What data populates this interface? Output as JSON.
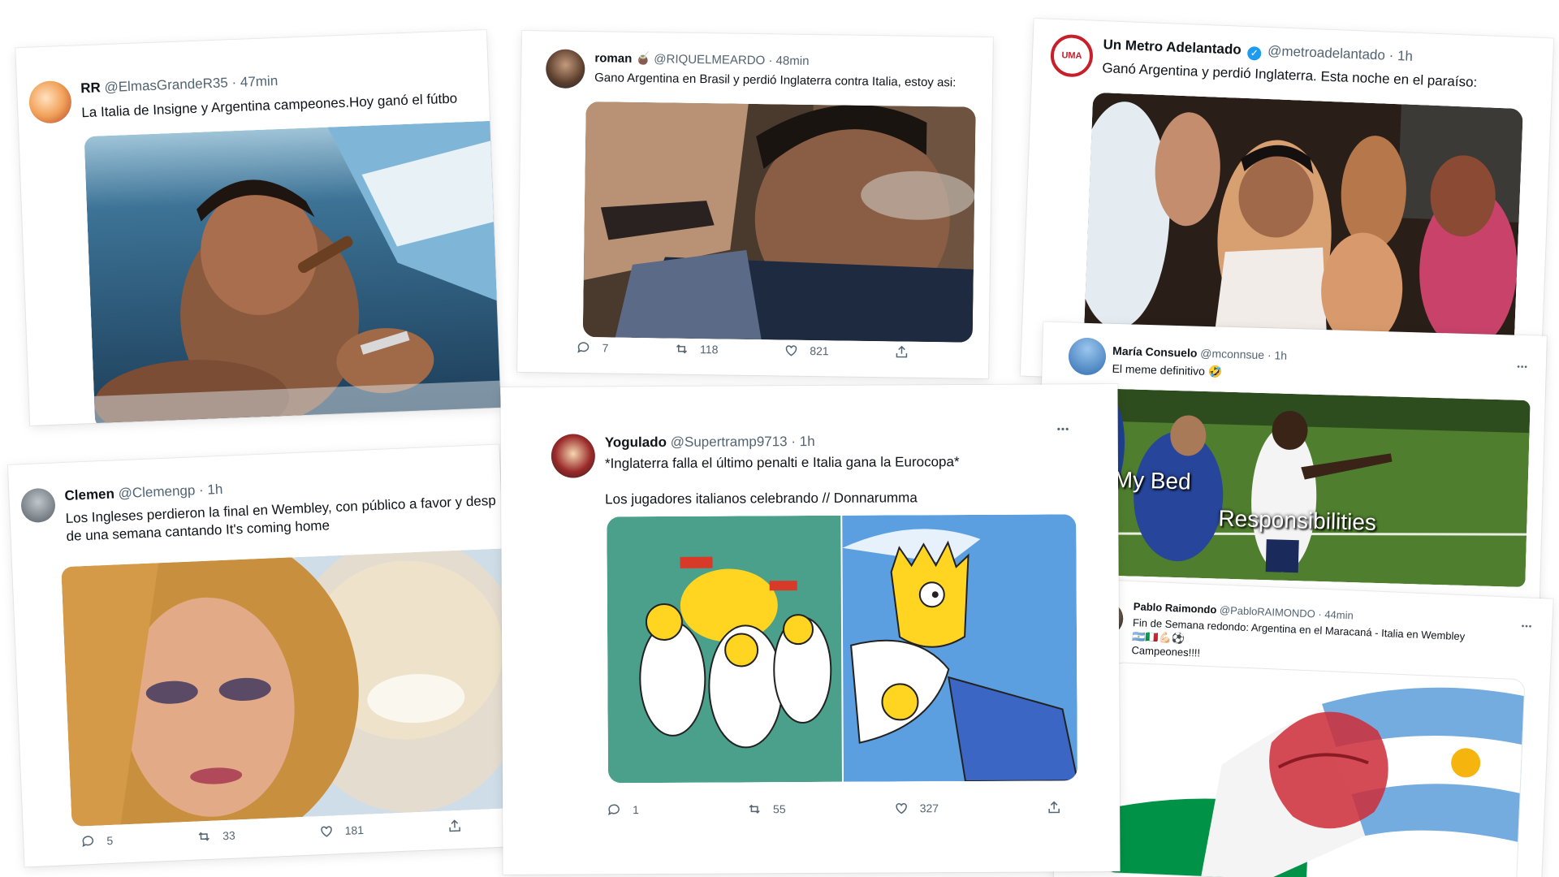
{
  "tweets": {
    "rr": {
      "name": "RR",
      "handle": "@ElmasGrandeR35",
      "time": "47min",
      "text": "La Italia de Insigne y Argentina campeones.Hoy ganó el fútbo"
    },
    "roman": {
      "name": "roman",
      "emoji": "🧉",
      "handle": "@RIQUELMEARDO",
      "time": "48min",
      "text": "Gano Argentina en Brasil y perdió Inglaterra contra Italia, estoy asi:",
      "replies": "7",
      "retweets": "118",
      "likes": "821"
    },
    "metro": {
      "name": "Un Metro Adelantado",
      "avatar_text": "UMA",
      "handle": "@metroadelantado",
      "time": "1h",
      "text": "Ganó Argentina y perdió Inglaterra. Esta noche en el paraíso:"
    },
    "maria": {
      "name": "María Consuelo",
      "handle": "@mconnsue",
      "time": "1h",
      "text": "El meme definitivo",
      "emoji": "🤣",
      "caption_a": "My Bed",
      "caption_b": "Responsibilities"
    },
    "clemen": {
      "name": "Clemen",
      "handle": "@Clemengp",
      "time": "1h",
      "text_line1": "Los Ingleses perdieron la final en Wembley, con público a favor y desp",
      "text_line2": "de una semana cantando It's coming home",
      "replies": "5",
      "retweets": "33",
      "likes": "181"
    },
    "yogulado": {
      "name": "Yogulado",
      "handle": "@Supertramp9713",
      "time": "1h",
      "text_line1": "*Inglaterra falla el último penalti e Italia gana la Eurocopa*",
      "text_line2": "Los jugadores italianos celebrando // Donnarumma",
      "replies": "1",
      "retweets": "55",
      "likes": "327"
    },
    "pablo": {
      "name": "Pablo Raimondo",
      "handle": "@PabloRAIMONDO",
      "time": "44min",
      "text_line1": "Fin de Semana redondo: Argentina en el Maracaná - Italia en Wembley",
      "emoji_line": "🇦🇷🇮🇹💪🏻⚽",
      "text_line3": "Campeones!!!!"
    }
  },
  "separator": "·",
  "more_icon": "•••",
  "colors": {
    "text_primary": "#0f1419",
    "text_secondary": "#536471",
    "verified_blue": "#1d9bf0",
    "argentina_blue": "#74acdf",
    "italy_green": "#009246",
    "italy_red": "#ce2b37"
  }
}
